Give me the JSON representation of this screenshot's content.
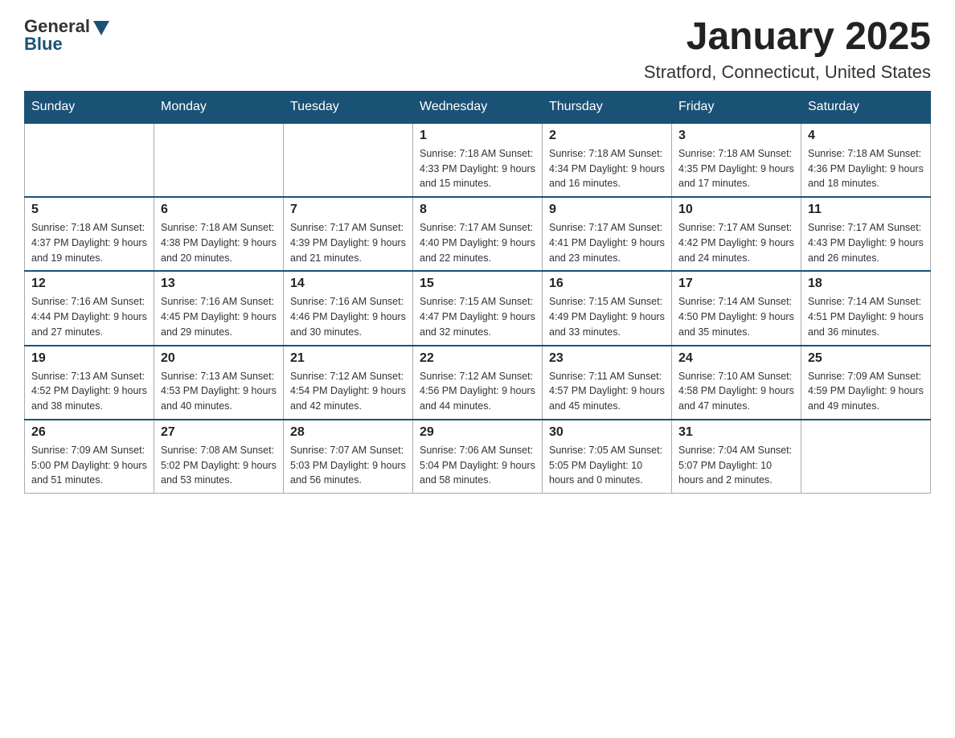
{
  "logo": {
    "general": "General",
    "blue": "Blue"
  },
  "header": {
    "month_title": "January 2025",
    "location": "Stratford, Connecticut, United States"
  },
  "days_of_week": [
    "Sunday",
    "Monday",
    "Tuesday",
    "Wednesday",
    "Thursday",
    "Friday",
    "Saturday"
  ],
  "weeks": [
    [
      {
        "num": "",
        "info": ""
      },
      {
        "num": "",
        "info": ""
      },
      {
        "num": "",
        "info": ""
      },
      {
        "num": "1",
        "info": "Sunrise: 7:18 AM\nSunset: 4:33 PM\nDaylight: 9 hours\nand 15 minutes."
      },
      {
        "num": "2",
        "info": "Sunrise: 7:18 AM\nSunset: 4:34 PM\nDaylight: 9 hours\nand 16 minutes."
      },
      {
        "num": "3",
        "info": "Sunrise: 7:18 AM\nSunset: 4:35 PM\nDaylight: 9 hours\nand 17 minutes."
      },
      {
        "num": "4",
        "info": "Sunrise: 7:18 AM\nSunset: 4:36 PM\nDaylight: 9 hours\nand 18 minutes."
      }
    ],
    [
      {
        "num": "5",
        "info": "Sunrise: 7:18 AM\nSunset: 4:37 PM\nDaylight: 9 hours\nand 19 minutes."
      },
      {
        "num": "6",
        "info": "Sunrise: 7:18 AM\nSunset: 4:38 PM\nDaylight: 9 hours\nand 20 minutes."
      },
      {
        "num": "7",
        "info": "Sunrise: 7:17 AM\nSunset: 4:39 PM\nDaylight: 9 hours\nand 21 minutes."
      },
      {
        "num": "8",
        "info": "Sunrise: 7:17 AM\nSunset: 4:40 PM\nDaylight: 9 hours\nand 22 minutes."
      },
      {
        "num": "9",
        "info": "Sunrise: 7:17 AM\nSunset: 4:41 PM\nDaylight: 9 hours\nand 23 minutes."
      },
      {
        "num": "10",
        "info": "Sunrise: 7:17 AM\nSunset: 4:42 PM\nDaylight: 9 hours\nand 24 minutes."
      },
      {
        "num": "11",
        "info": "Sunrise: 7:17 AM\nSunset: 4:43 PM\nDaylight: 9 hours\nand 26 minutes."
      }
    ],
    [
      {
        "num": "12",
        "info": "Sunrise: 7:16 AM\nSunset: 4:44 PM\nDaylight: 9 hours\nand 27 minutes."
      },
      {
        "num": "13",
        "info": "Sunrise: 7:16 AM\nSunset: 4:45 PM\nDaylight: 9 hours\nand 29 minutes."
      },
      {
        "num": "14",
        "info": "Sunrise: 7:16 AM\nSunset: 4:46 PM\nDaylight: 9 hours\nand 30 minutes."
      },
      {
        "num": "15",
        "info": "Sunrise: 7:15 AM\nSunset: 4:47 PM\nDaylight: 9 hours\nand 32 minutes."
      },
      {
        "num": "16",
        "info": "Sunrise: 7:15 AM\nSunset: 4:49 PM\nDaylight: 9 hours\nand 33 minutes."
      },
      {
        "num": "17",
        "info": "Sunrise: 7:14 AM\nSunset: 4:50 PM\nDaylight: 9 hours\nand 35 minutes."
      },
      {
        "num": "18",
        "info": "Sunrise: 7:14 AM\nSunset: 4:51 PM\nDaylight: 9 hours\nand 36 minutes."
      }
    ],
    [
      {
        "num": "19",
        "info": "Sunrise: 7:13 AM\nSunset: 4:52 PM\nDaylight: 9 hours\nand 38 minutes."
      },
      {
        "num": "20",
        "info": "Sunrise: 7:13 AM\nSunset: 4:53 PM\nDaylight: 9 hours\nand 40 minutes."
      },
      {
        "num": "21",
        "info": "Sunrise: 7:12 AM\nSunset: 4:54 PM\nDaylight: 9 hours\nand 42 minutes."
      },
      {
        "num": "22",
        "info": "Sunrise: 7:12 AM\nSunset: 4:56 PM\nDaylight: 9 hours\nand 44 minutes."
      },
      {
        "num": "23",
        "info": "Sunrise: 7:11 AM\nSunset: 4:57 PM\nDaylight: 9 hours\nand 45 minutes."
      },
      {
        "num": "24",
        "info": "Sunrise: 7:10 AM\nSunset: 4:58 PM\nDaylight: 9 hours\nand 47 minutes."
      },
      {
        "num": "25",
        "info": "Sunrise: 7:09 AM\nSunset: 4:59 PM\nDaylight: 9 hours\nand 49 minutes."
      }
    ],
    [
      {
        "num": "26",
        "info": "Sunrise: 7:09 AM\nSunset: 5:00 PM\nDaylight: 9 hours\nand 51 minutes."
      },
      {
        "num": "27",
        "info": "Sunrise: 7:08 AM\nSunset: 5:02 PM\nDaylight: 9 hours\nand 53 minutes."
      },
      {
        "num": "28",
        "info": "Sunrise: 7:07 AM\nSunset: 5:03 PM\nDaylight: 9 hours\nand 56 minutes."
      },
      {
        "num": "29",
        "info": "Sunrise: 7:06 AM\nSunset: 5:04 PM\nDaylight: 9 hours\nand 58 minutes."
      },
      {
        "num": "30",
        "info": "Sunrise: 7:05 AM\nSunset: 5:05 PM\nDaylight: 10 hours\nand 0 minutes."
      },
      {
        "num": "31",
        "info": "Sunrise: 7:04 AM\nSunset: 5:07 PM\nDaylight: 10 hours\nand 2 minutes."
      },
      {
        "num": "",
        "info": ""
      }
    ]
  ]
}
